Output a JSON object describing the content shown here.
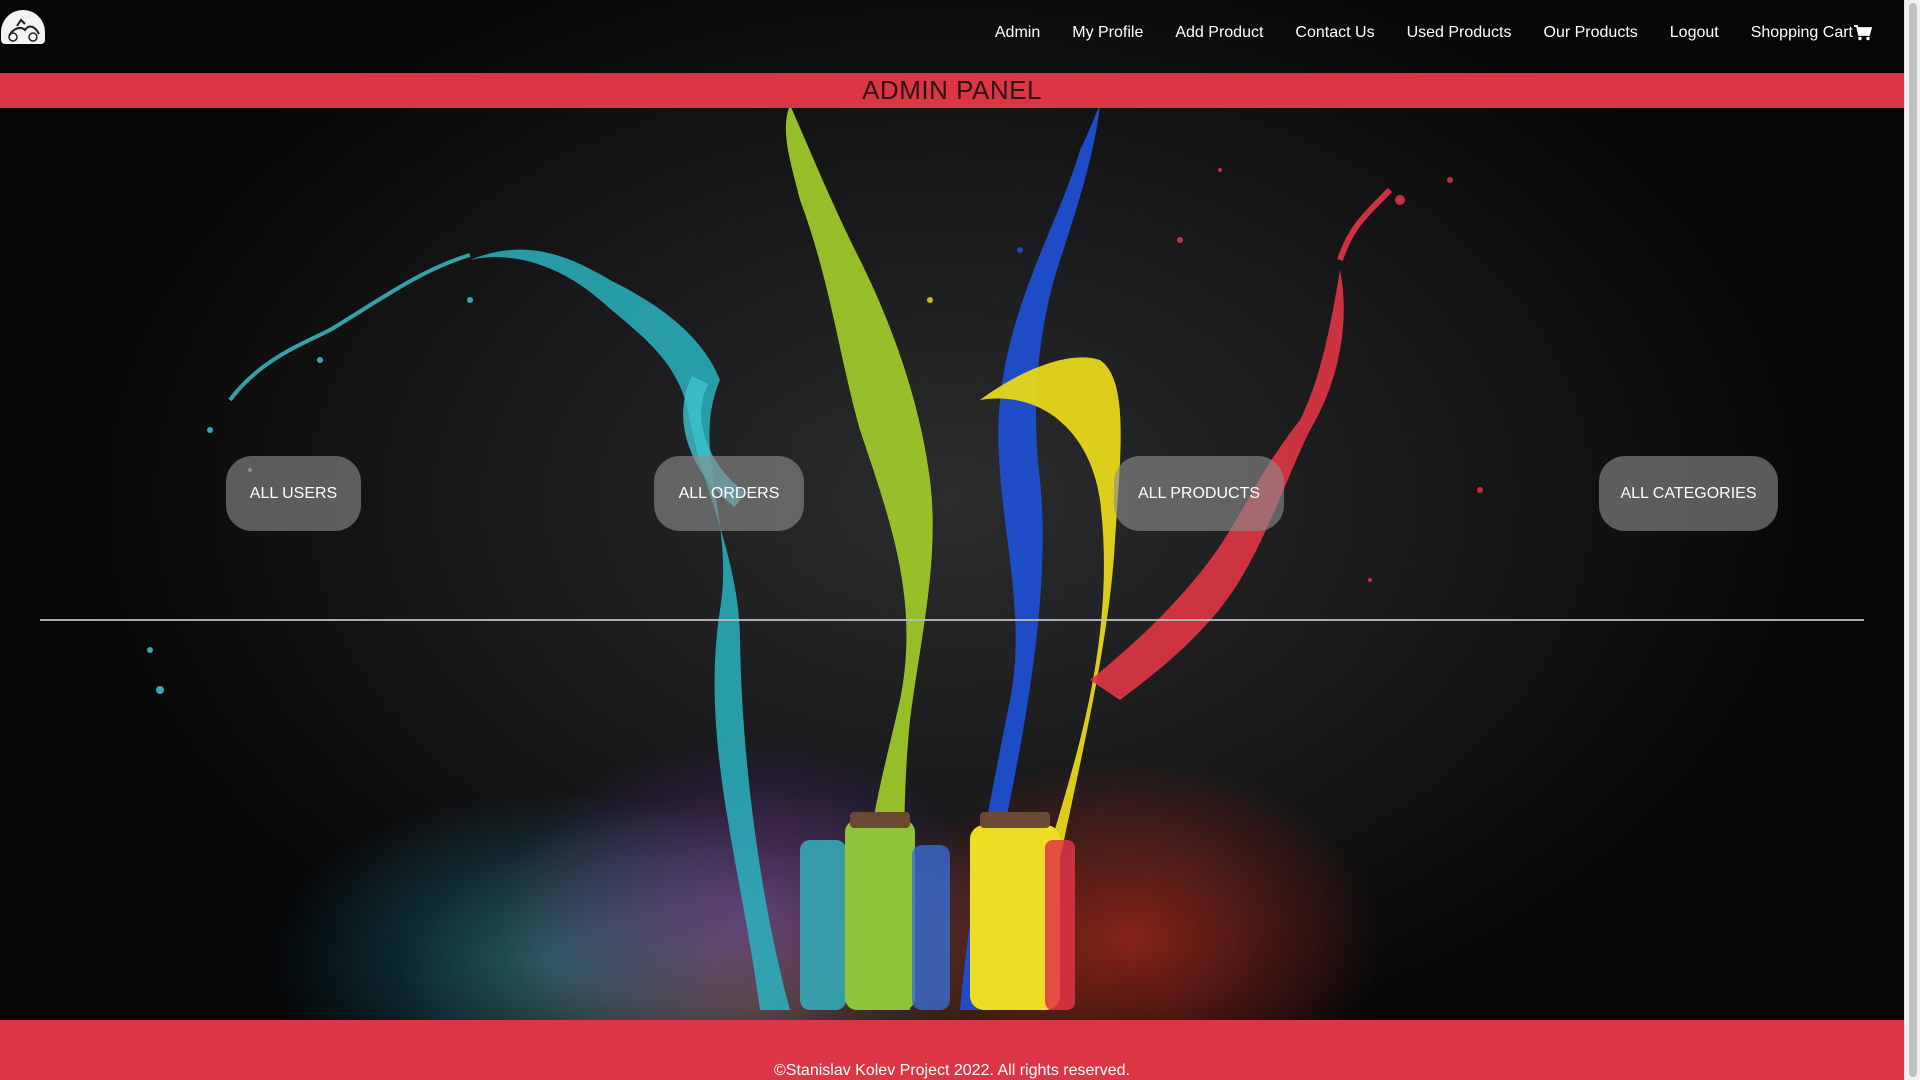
{
  "navbar": {
    "logo_icon": "rider-logo-icon",
    "links": [
      {
        "label": "Admin"
      },
      {
        "label": "My Profile"
      },
      {
        "label": "Add Product"
      },
      {
        "label": "Contact Us"
      },
      {
        "label": "Used Products"
      },
      {
        "label": "Our Products"
      },
      {
        "label": "Logout"
      },
      {
        "label": "Shopping Cart",
        "icon": "shopping-cart-icon"
      }
    ]
  },
  "header": {
    "title": "ADMIN PANEL"
  },
  "admin_buttons": {
    "users": "ALL USERS",
    "orders": "ALL ORDERS",
    "products": "ALL PRODUCTS",
    "categories": "ALL CATEGORIES"
  },
  "footer": {
    "text": "©Stanislav Kolev Project 2022. All rights reserved."
  },
  "colors": {
    "accent": "#dc3545",
    "button_bg": "rgba(140,140,140,0.62)",
    "nav_text": "#ffffff"
  }
}
